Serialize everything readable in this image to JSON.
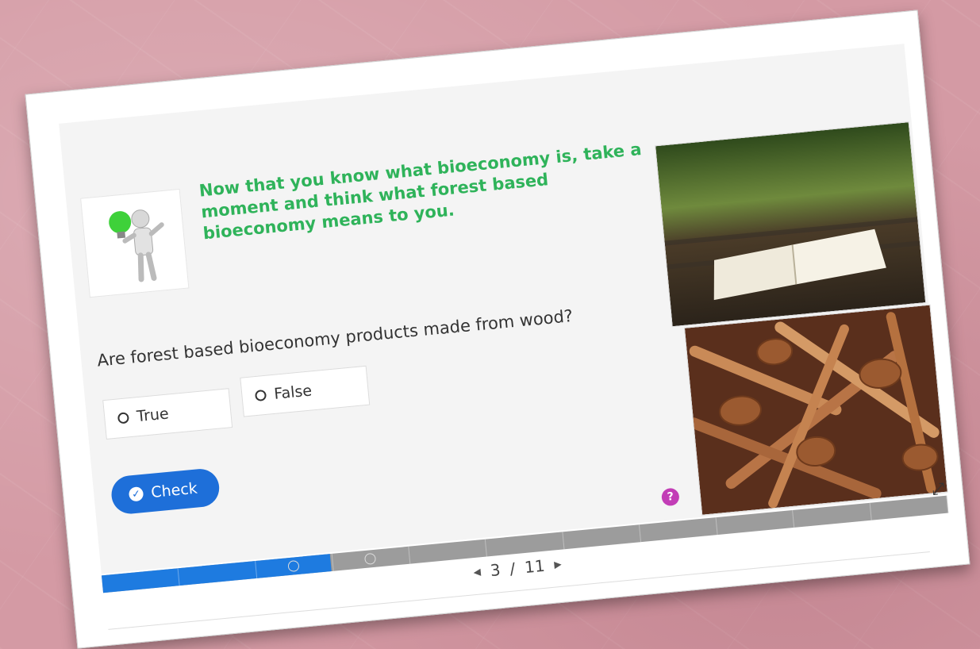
{
  "heading": "Now that you know what bioeconomy is, take a moment and think what forest based bioeconomy means to you.",
  "question": "Are forest based bioeconomy products made from wood?",
  "options": {
    "true_label": "True",
    "false_label": "False"
  },
  "check_label": "Check",
  "help_icon": "?",
  "pager": {
    "current": "3",
    "separator": "/",
    "total": "11"
  },
  "progress": {
    "completed_fraction": 0.27
  },
  "colors": {
    "accent": "#1e6fd9",
    "heading": "#2fb35a",
    "help": "#c23db6"
  }
}
